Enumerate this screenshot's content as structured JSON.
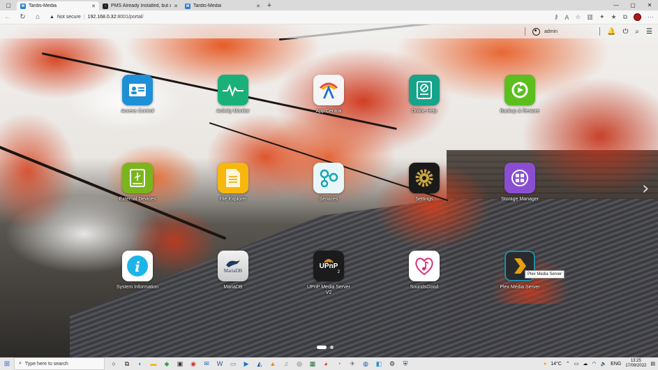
{
  "browser": {
    "tabs": [
      {
        "title": "Tardis-Media",
        "active": true
      },
      {
        "title": "PMS Already Installed, but askin",
        "active": false
      },
      {
        "title": "Tardis-Media",
        "active": false
      }
    ],
    "security_label": "Not secure",
    "url_host": "192.168.0.32",
    "url_rest": ":8001/portal/"
  },
  "portal": {
    "username": "admin",
    "apps": [
      {
        "label": "Access Control"
      },
      {
        "label": "Activity Monitor"
      },
      {
        "label": "App Central"
      },
      {
        "label": "Online Help"
      },
      {
        "label": "Backup & Restore"
      },
      {
        "label": "External Devices"
      },
      {
        "label": "File Explorer"
      },
      {
        "label": "Services"
      },
      {
        "label": "Settings"
      },
      {
        "label": "Storage Manager"
      },
      {
        "label": "System Information"
      },
      {
        "label": "MariaDB"
      },
      {
        "label": "UPnP Media Server V2"
      },
      {
        "label": "SoundsGood"
      },
      {
        "label": "Plex Media Server"
      }
    ],
    "tooltip": "Plex Media Server",
    "icon_text": {
      "upnp": "UPnP",
      "upnp_version": "2",
      "mariadb": "MariaDB",
      "info": "i"
    }
  },
  "taskbar": {
    "search_placeholder": "Type here to search",
    "weather": "14°C",
    "language": "ENG",
    "time": "13:25",
    "date": "17/09/2022"
  }
}
